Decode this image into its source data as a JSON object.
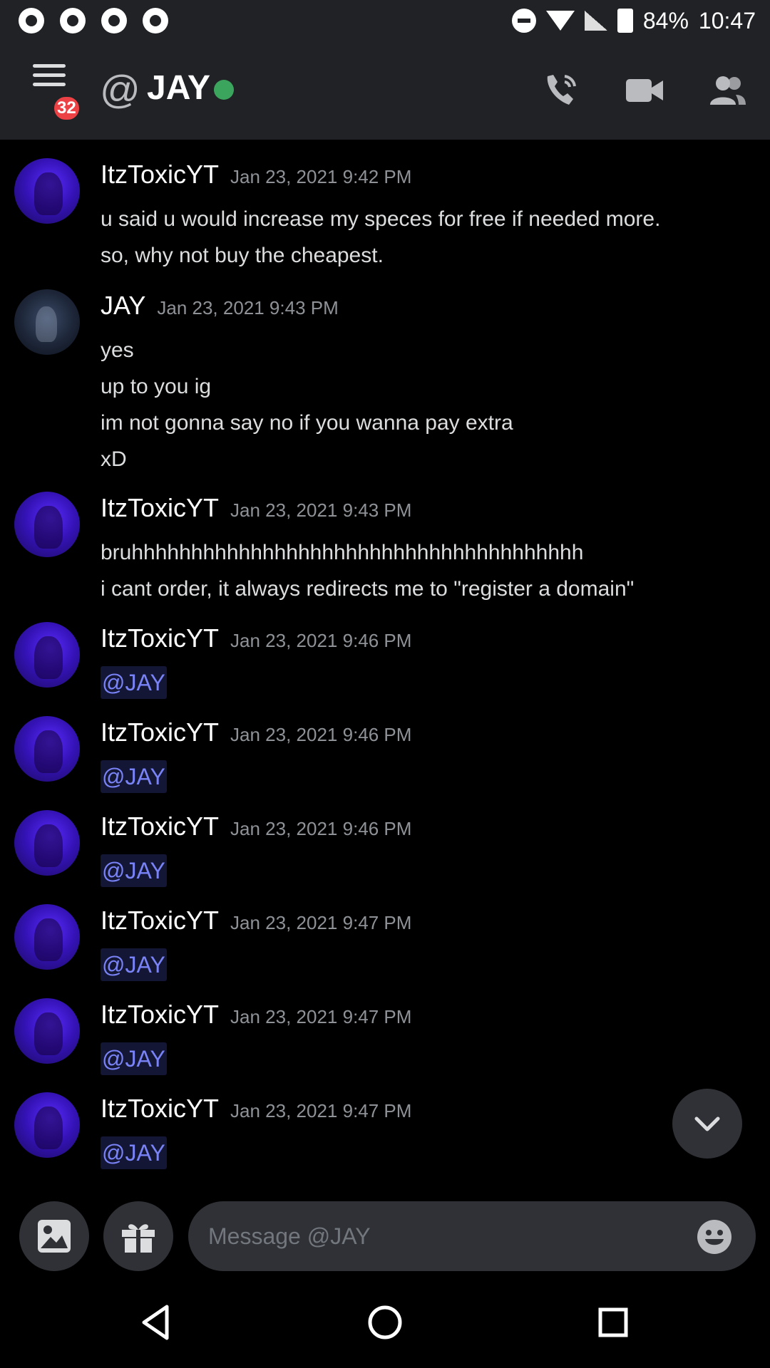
{
  "status_bar": {
    "battery": "84%",
    "time": "10:47",
    "left_icons": [
      "music-icon",
      "aperture-icon",
      "aperture-icon",
      "sync-icon"
    ]
  },
  "header": {
    "unread_badge": "32",
    "at_symbol": "@",
    "title": "JAY",
    "presence": "online"
  },
  "messages": [
    {
      "author": "ItzToxicYT",
      "timestamp": "Jan 23, 2021 9:42 PM",
      "avatar": "itztoxic",
      "lines": [
        "u said u would increase my speces for free if needed more.",
        "so, why not buy the cheapest."
      ]
    },
    {
      "author": "JAY",
      "timestamp": "Jan 23, 2021 9:43 PM",
      "avatar": "jay",
      "lines": [
        "yes",
        "up to you ig",
        "im not gonna say no if you wanna pay extra",
        "xD"
      ]
    },
    {
      "author": "ItzToxicYT",
      "timestamp": "Jan 23, 2021 9:43 PM",
      "avatar": "itztoxic",
      "lines": [
        "bruhhhhhhhhhhhhhhhhhhhhhhhhhhhhhhhhhhhhhh",
        "i cant order, it always redirects me to \"register a domain\""
      ]
    },
    {
      "author": "ItzToxicYT",
      "timestamp": "Jan 23, 2021 9:46 PM",
      "avatar": "itztoxic",
      "mention": "@JAY"
    },
    {
      "author": "ItzToxicYT",
      "timestamp": "Jan 23, 2021 9:46 PM",
      "avatar": "itztoxic",
      "mention": "@JAY"
    },
    {
      "author": "ItzToxicYT",
      "timestamp": "Jan 23, 2021 9:46 PM",
      "avatar": "itztoxic",
      "mention": "@JAY"
    },
    {
      "author": "ItzToxicYT",
      "timestamp": "Jan 23, 2021 9:47 PM",
      "avatar": "itztoxic",
      "mention": "@JAY"
    },
    {
      "author": "ItzToxicYT",
      "timestamp": "Jan 23, 2021 9:47 PM",
      "avatar": "itztoxic",
      "mention": "@JAY"
    },
    {
      "author": "ItzToxicYT",
      "timestamp": "Jan 23, 2021 9:47 PM",
      "avatar": "itztoxic",
      "mention": "@JAY"
    }
  ],
  "composer": {
    "placeholder": "Message @JAY"
  },
  "colors": {
    "background": "#000000",
    "header": "#202225",
    "mention": "#7983f5",
    "online": "#3ba55d",
    "badge": "#ed4245"
  }
}
